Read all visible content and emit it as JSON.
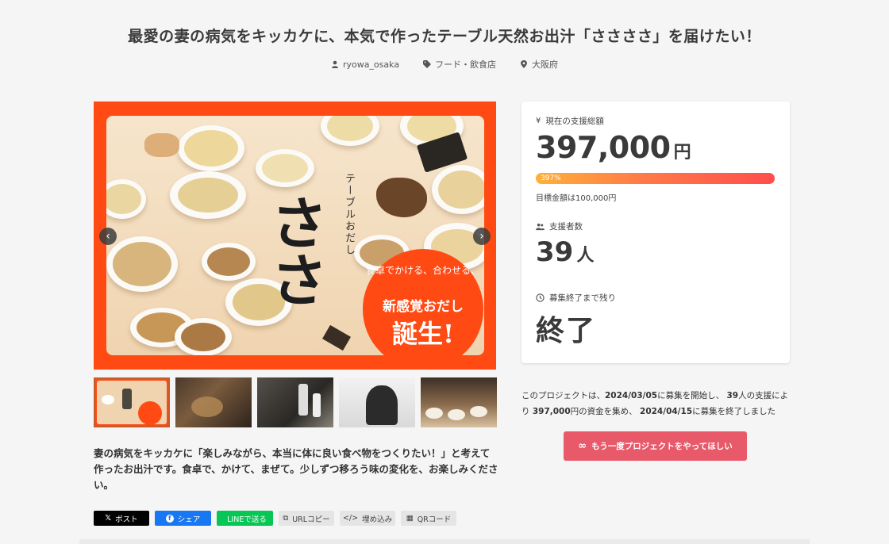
{
  "title": "最愛の妻の病気をキッカケに、本気で作ったテーブル天然お出汁「ささささ」を届けたい！",
  "meta": {
    "author": "ryowa_osaka",
    "category": "フード・飲食店",
    "location": "大阪府"
  },
  "hero": {
    "brand_big": "ささ",
    "brand_small": "テーブルおだし",
    "badge_line1": "食卓でかける、合わせる、",
    "badge_line2": "新感覚おだし",
    "badge_line3": "誕生!",
    "prev_icon": "chevron-left-icon",
    "next_icon": "chevron-right-icon"
  },
  "lead": "妻の病気をキッカケに「楽しみながら、本当に体に良い食べ物をつくりたい！」と考えて作ったお出汁です。食卓で、かけて、まぜて。少しずつ移ろう味の変化を、お楽しみください。",
  "share": {
    "x": "ポスト",
    "facebook": "シェア",
    "line": "LINEで送る",
    "url_copy": "URLコピー",
    "embed": "埋め込み",
    "qr": "QRコード"
  },
  "stats": {
    "total_label": "現在の支援総額",
    "total_amount": "397,000",
    "total_unit": "円",
    "progress_text": "397%",
    "progress_percent": 397,
    "goal": "目標金額は100,000円",
    "backers_label": "支援者数",
    "backers_count": "39",
    "backers_unit": "人",
    "remaining_label": "募集終了まで残り",
    "remaining_value": "終了"
  },
  "summary": {
    "p1": "このプロジェクトは、",
    "start": "2024/03/05",
    "p2": "に募集を開始し、",
    "backers": "39",
    "p3": "人の支援により",
    "amount": "397,000",
    "p4": "円の資金を集め、",
    "end": "2024/04/15",
    "p5": "に募集を終了しました"
  },
  "again_button": "もう一度プロジェクトをやってほしい",
  "colors": {
    "accent": "#e8596a",
    "hero_orange": "#ff4a14",
    "progress_start": "#ffb03a",
    "progress_end": "#ff4d4d"
  }
}
